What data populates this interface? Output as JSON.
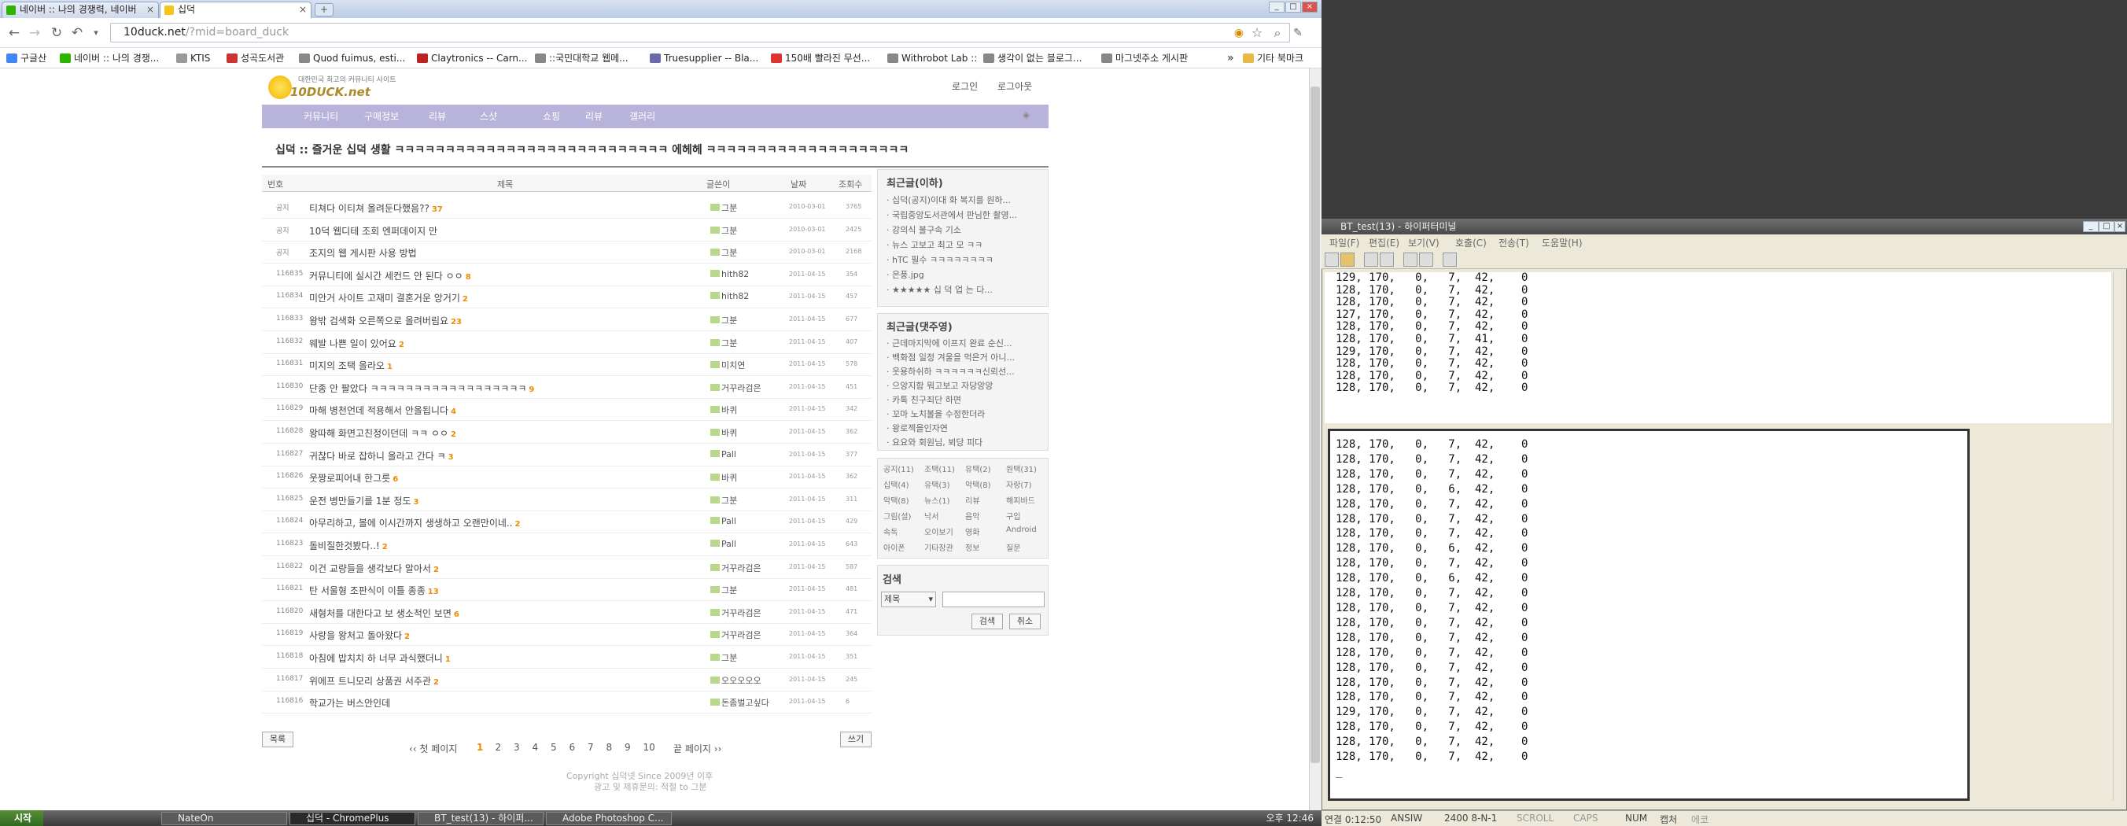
{
  "browser": {
    "tabs": [
      {
        "label": "네이버 :: 나의 경쟁력, 네이버"
      },
      {
        "label": "십덕"
      }
    ],
    "url_main": "10duck.net",
    "url_rest": "/?mid=board_duck",
    "bookmarks": [
      "구글산",
      "네이버 :: 나의 경쟁...",
      "KTIS",
      "성곡도서관",
      "Quod fuimus, esti...",
      "Claytronics -- Carn...",
      "::국민대학교 웹메...",
      "Truesupplier -- Bla...",
      "150배 빨라진 무선...",
      "Withrobot Lab ::",
      "생각이 없는 블로그...",
      "마그넷주소 게시판"
    ],
    "bookmarks_more": "기타 북마크"
  },
  "site": {
    "logo": "10DUCK.net",
    "logo_sub": "대한민국 최고의 커뮤니티 사이트",
    "login": "로그인",
    "logout": "로그아웃",
    "menu": [
      "커뮤니티",
      "구매정보",
      "리뷰",
      "스샷",
      "쇼핑",
      "리뷰",
      "갤러리"
    ],
    "page_title": "십덕 :: 즐거운 십덕 생활 ㅋㅋㅋㅋㅋㅋㅋㅋㅋㅋㅋㅋㅋㅋㅋㅋㅋㅋㅋㅋㅋㅋㅋㅋㅋㅋㅋ 에헤헤 ㅋㅋㅋㅋㅋㅋㅋㅋㅋㅋㅋㅋㅋㅋㅋㅋㅋㅋㅋㅋ",
    "headers": {
      "no": "번호",
      "title": "제목",
      "author": "글쓴이",
      "date": "날짜",
      "hits": "조회수"
    },
    "rows": [
      {
        "no": "공지",
        "title": "티쳐다 이티쳐 올려둔다했음??",
        "c": "37",
        "au": "그분",
        "dt": "2010-03-01",
        "hit": "3765"
      },
      {
        "no": "공지",
        "title": "10덕 웹디테 조회 엔퍼데이지 만",
        "c": "",
        "au": "그분",
        "dt": "2010-03-01",
        "hit": "2425"
      },
      {
        "no": "공지",
        "title": "조지의 웹 게시판 사용 방법",
        "c": "",
        "au": "그분",
        "dt": "2010-03-01",
        "hit": "2168"
      },
      {
        "no": "116835",
        "title": "커뮤니티에 실시간 세컨드 안 된다 ㅇㅇ",
        "c": "8",
        "au": "hith82",
        "dt": "2011-04-15",
        "hit": "354"
      },
      {
        "no": "116834",
        "title": "미안거 사이트 고재미 결혼거운 앙거기",
        "c": "2",
        "au": "hith82",
        "dt": "2011-04-15",
        "hit": "457"
      },
      {
        "no": "116833",
        "title": "왕밖 검색화 오른쪽으로 올려버림요",
        "c": "23",
        "au": "그분",
        "dt": "2011-04-15",
        "hit": "677"
      },
      {
        "no": "116832",
        "title": "웨발 나쁜 일이 있어요",
        "c": "2",
        "au": "그분",
        "dt": "2011-04-15",
        "hit": "407"
      },
      {
        "no": "116831",
        "title": "미지의 조택 올라오",
        "c": "1",
        "au": "미치연",
        "dt": "2011-04-15",
        "hit": "578"
      },
      {
        "no": "116830",
        "title": "단종 안 팔았다 ㅋㅋㅋㅋㅋㅋㅋㅋㅋㅋㅋㅋㅋㅋㅋㅋㅋㅋ",
        "c": "9",
        "au": "거꾸라검은",
        "dt": "2011-04-15",
        "hit": "451"
      },
      {
        "no": "116829",
        "title": "마해 병천언데 적용해서 안올됩니다",
        "c": "4",
        "au": "바퀴",
        "dt": "2011-04-15",
        "hit": "342"
      },
      {
        "no": "116828",
        "title": "왕따해 화면고친정이던데 ㅋㅋ ㅇㅇ",
        "c": "2",
        "au": "바퀴",
        "dt": "2011-04-15",
        "hit": "362"
      },
      {
        "no": "116827",
        "title": "귀찮다 바로 잡하니 올라고 간다 ㅋ",
        "c": "3",
        "au": "Pall",
        "dt": "2011-04-15",
        "hit": "377"
      },
      {
        "no": "116826",
        "title": "웃짱로피어내 한그릇",
        "c": "6",
        "au": "바퀴",
        "dt": "2011-04-15",
        "hit": "362"
      },
      {
        "no": "116825",
        "title": "운전 병만들기를 1분 정도",
        "c": "3",
        "au": "그분",
        "dt": "2011-04-15",
        "hit": "311"
      },
      {
        "no": "116824",
        "title": "아무리하고, 볼에 이시간까지 생생하고 오랜만이네..",
        "c": "2",
        "au": "Pall",
        "dt": "2011-04-15",
        "hit": "429"
      },
      {
        "no": "116823",
        "title": "돌비질한것봤다..!",
        "c": "2",
        "au": "Pall",
        "dt": "2011-04-15",
        "hit": "643"
      },
      {
        "no": "116822",
        "title": "이건 교량들을 생각보다 알아서",
        "c": "2",
        "au": "거꾸라검은",
        "dt": "2011-04-15",
        "hit": "587"
      },
      {
        "no": "116821",
        "title": "탄 서울형 조판식이 이틀 종종",
        "c": "13",
        "au": "그분",
        "dt": "2011-04-15",
        "hit": "481"
      },
      {
        "no": "116820",
        "title": "새형처를 대한다고 보 생소적인 보면",
        "c": "6",
        "au": "거꾸라검은",
        "dt": "2011-04-15",
        "hit": "471"
      },
      {
        "no": "116819",
        "title": "사랑을 왕처고 돌아왔다",
        "c": "2",
        "au": "거꾸라검은",
        "dt": "2011-04-15",
        "hit": "364"
      },
      {
        "no": "116818",
        "title": "아침에 밥치치 하 너무 과식했더니",
        "c": "1",
        "au": "그분",
        "dt": "2011-04-15",
        "hit": "351"
      },
      {
        "no": "116817",
        "title": "위에프 트니모리 상품권 서주관",
        "c": "2",
        "au": "오오오오오",
        "dt": "2011-04-15",
        "hit": "245"
      },
      {
        "no": "116816",
        "title": "학교가는 버스안인데",
        "c": "",
        "au": "돈좀벌고싶다",
        "dt": "2011-04-15",
        "hit": "6"
      }
    ],
    "list_btn": "목록",
    "write_btn": "쓰기",
    "pager": {
      "first": "‹‹ 첫 페이지",
      "pages": [
        "1",
        "2",
        "3",
        "4",
        "5",
        "6",
        "7",
        "8",
        "9",
        "10"
      ],
      "last": "끝 페이지 ››",
      "current": "1"
    },
    "side_recent_h": "최근글(이하)",
    "side_recent": [
      "· 십덕(공지)이대 화 복지를 원하...",
      "· 국립중앙도서관에서 판님한 촬영...",
      "· 강의식 불구속 기소",
      "· 뉴스 고보고 최고 모 ㅋㅋ",
      "· hTC 필수 ㅋㅋㅋㅋㅋㅋㅋㅋ",
      "· 은풍.jpg",
      "· ★★★★★ 십 덕 업 는 다..."
    ],
    "side_comments_h": "최근글(댓주영)",
    "side_comments": [
      "· 근데마지막에 이프지 완료 순신...",
      "· 백화점 일정 겨울을 먹은거 아니...",
      "· 웃용하쉬하 ㅋㅋㅋㅋㅋㅋ신뢰선...",
      "· 으앙지함 뭐고보고 자당앙앙",
      "· 카톡 친구죄단 하면",
      "· 꼬마 노치볼을 수정한더라",
      "· 왕로젝을인자연",
      "· 요요와 회원님, 뵈당 피다"
    ],
    "categories": [
      "공지(11)",
      "조택(11)",
      "유택(2)",
      "원택(31)",
      "십택(4)",
      "유택(3)",
      "악택(8)",
      "자랑(7)",
      "악택(8)",
      "뉴스(1)",
      "리뷰",
      "해피바드",
      "그림(설)",
      "낙서",
      "음악",
      "구입",
      "속독",
      "오이보기",
      "영화",
      "Android",
      "아이폰",
      "기타장관",
      "정보",
      "질문"
    ],
    "search_h": "검색",
    "search_sel": "제목",
    "search_btn": "검색",
    "cancel_btn": "취소",
    "footer1": "Copyright 십덕넷 Since 2009년 이후",
    "footer2": "광고 및 제휴문의: 적절 to 그분"
  },
  "notepad": {
    "title": "BT_test(13) - 하이퍼터미널",
    "menu": [
      "파일(F)",
      "편집(E)",
      "보기(V)",
      "호출(C)",
      "전송(T)",
      "도움말(H)"
    ],
    "lines_top": [
      "129, 170,   0,   7,  42,    0",
      "128, 170,   0,   7,  42,    0",
      "128, 170,   0,   7,  42,    0",
      "127, 170,   0,   7,  42,    0",
      "128, 170,   0,   7,  42,    0",
      "128, 170,   0,   7,  41,    0",
      "129, 170,   0,   7,  42,    0",
      "128, 170,   0,   7,  42,    0",
      "128, 170,   0,   7,  42,    0",
      "128, 170,   0,   7,  42,    0"
    ],
    "lines_main": [
      "128, 170,   0,   7,  42,    0",
      "128, 170,   0,   7,  42,    0",
      "128, 170,   0,   7,  42,    0",
      "128, 170,   0,   6,  42,    0",
      "128, 170,   0,   7,  42,    0",
      "128, 170,   0,   7,  42,    0",
      "128, 170,   0,   7,  42,    0",
      "128, 170,   0,   6,  42,    0",
      "128, 170,   0,   7,  42,    0",
      "128, 170,   0,   6,  42,    0",
      "128, 170,   0,   7,  42,    0",
      "128, 170,   0,   7,  42,    0",
      "128, 170,   0,   7,  42,    0",
      "128, 170,   0,   7,  42,    0",
      "128, 170,   0,   7,  42,    0",
      "128, 170,   0,   7,  42,    0",
      "128, 170,   0,   7,  42,    0",
      "128, 170,   0,   7,  42,    0",
      "129, 170,   0,   7,  42,    0",
      "128, 170,   0,   7,  42,    0",
      "128, 170,   0,   7,  42,    0",
      "128, 170,   0,   7,  42,    0",
      "_"
    ],
    "status": [
      "연결 0:12:50",
      "ANSIW",
      "2400 8-N-1",
      "SCROLL",
      "CAPS",
      "NUM",
      "캡처",
      "에코"
    ]
  },
  "taskbar": {
    "start": "시작",
    "tasks": [
      "NateOn",
      "십덕 - ChromePlus",
      "BT_test(13) - 하이퍼...",
      "Adobe Photoshop C..."
    ],
    "clock": "오후 12:46"
  }
}
